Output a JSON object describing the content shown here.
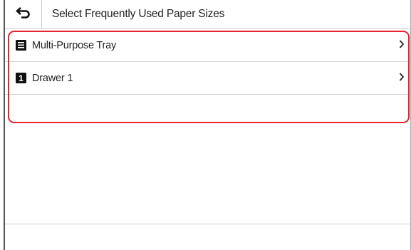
{
  "header": {
    "title": "Select Frequently Used Paper Sizes",
    "back_icon": "back-arrow-icon"
  },
  "list": {
    "items": [
      {
        "label": "Multi-Purpose Tray",
        "icon": "multi-purpose-tray-icon"
      },
      {
        "label": "Drawer 1",
        "icon": "drawer-1-icon",
        "icon_text": "1"
      }
    ]
  },
  "colors": {
    "highlight": "#e4242f",
    "divider": "#d4d4d4",
    "text": "#222222"
  }
}
